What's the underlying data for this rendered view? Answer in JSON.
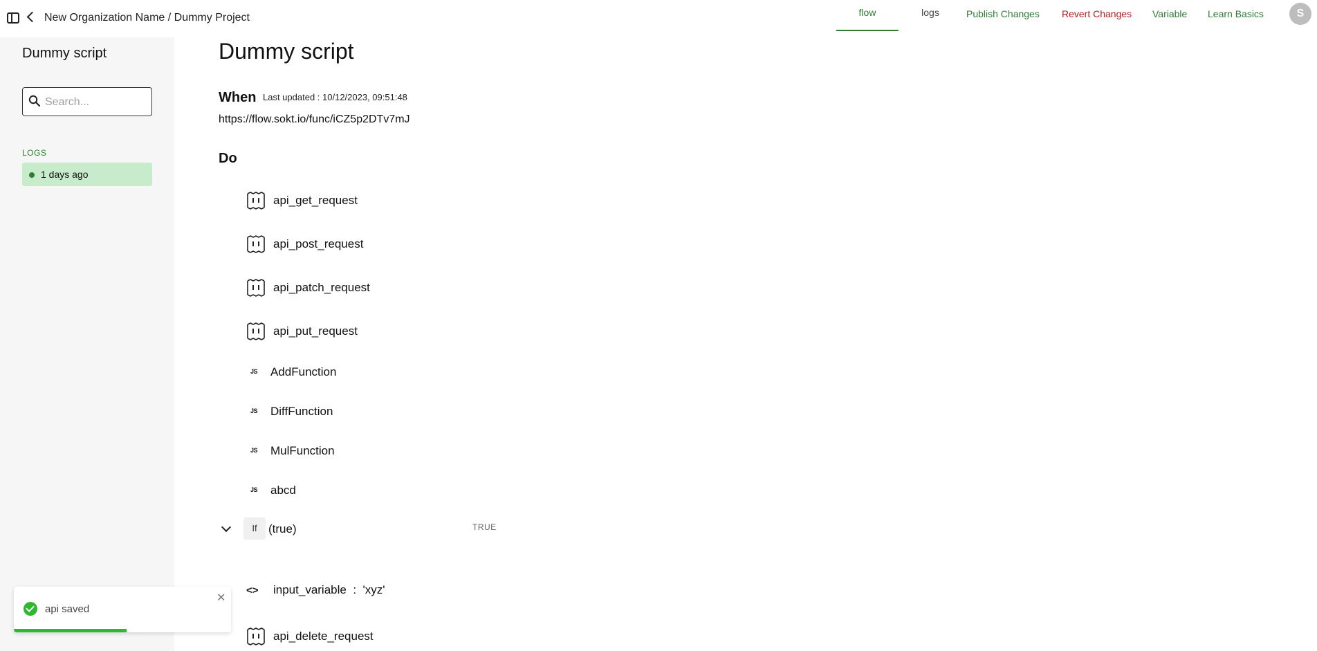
{
  "header": {
    "breadcrumb": "New Organization Name / Dummy Project",
    "tabs": [
      {
        "label": "flow",
        "active": true
      },
      {
        "label": "logs",
        "active": false
      }
    ],
    "actions": {
      "publish": "Publish Changes",
      "revert": "Revert Changes",
      "variable": "Variable",
      "learn": "Learn Basics"
    },
    "avatar_initial": "S"
  },
  "sidebar": {
    "title": "Dummy script",
    "search_placeholder": "Search...",
    "logs_heading": "LOGS",
    "log_items": [
      {
        "label": "1 days ago"
      }
    ]
  },
  "main": {
    "title": "Dummy script",
    "when_label": "When",
    "last_updated": "Last updated : 10/12/2023, 09:51:48",
    "url": "https://flow.sokt.io/func/iCZ5p2DTv7mJ",
    "do_label": "Do",
    "steps": [
      {
        "type": "api",
        "label": "api_get_request",
        "icon": "api-icon"
      },
      {
        "type": "api",
        "label": "api_post_request",
        "icon": "api-icon"
      },
      {
        "type": "api",
        "label": "api_patch_request",
        "icon": "api-icon"
      },
      {
        "type": "api",
        "label": "api_put_request",
        "icon": "api-icon"
      },
      {
        "type": "js",
        "label": "AddFunction",
        "icon": "js-icon",
        "badge": "JS"
      },
      {
        "type": "js",
        "label": "DiffFunction",
        "icon": "js-icon",
        "badge": "JS"
      },
      {
        "type": "js",
        "label": "MulFunction",
        "icon": "js-icon",
        "badge": "JS"
      },
      {
        "type": "js",
        "label": "abcd",
        "icon": "js-icon",
        "badge": "JS"
      }
    ],
    "if_block": {
      "badge": "If",
      "condition": "(true)",
      "result": "TRUE",
      "variable": {
        "name": "input_variable",
        "separator": ":",
        "value": "'xyz'"
      },
      "nested_step": {
        "type": "api",
        "label": "api_delete_request",
        "icon": "api-icon"
      }
    }
  },
  "toast": {
    "message": "api saved",
    "progress": 0.52
  },
  "colors": {
    "accent_green": "#2e7d32",
    "danger_red": "#b71c1c",
    "log_item_bg": "#c8ebcb",
    "toast_green": "#2eb82e"
  }
}
